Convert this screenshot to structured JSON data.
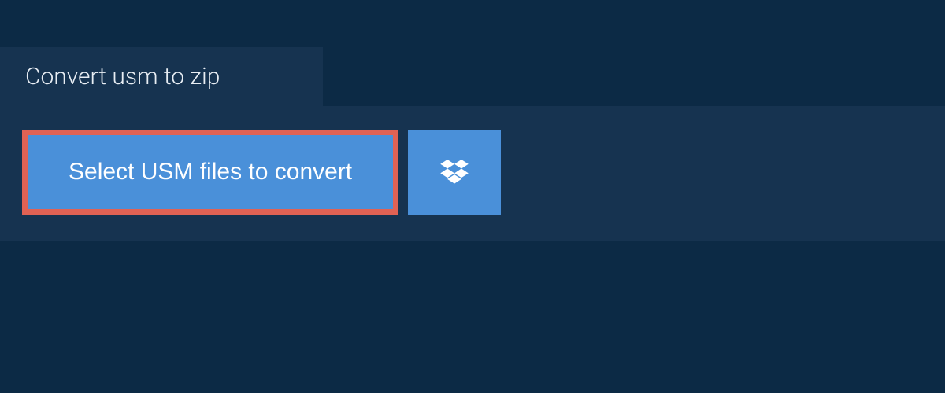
{
  "tab": {
    "title": "Convert usm to zip"
  },
  "actions": {
    "select_files_label": "Select USM files to convert"
  },
  "colors": {
    "background": "#0c2a45",
    "panel": "#163350",
    "button": "#4a90d9",
    "highlight_border": "#e06254",
    "text_light": "#ffffff"
  }
}
